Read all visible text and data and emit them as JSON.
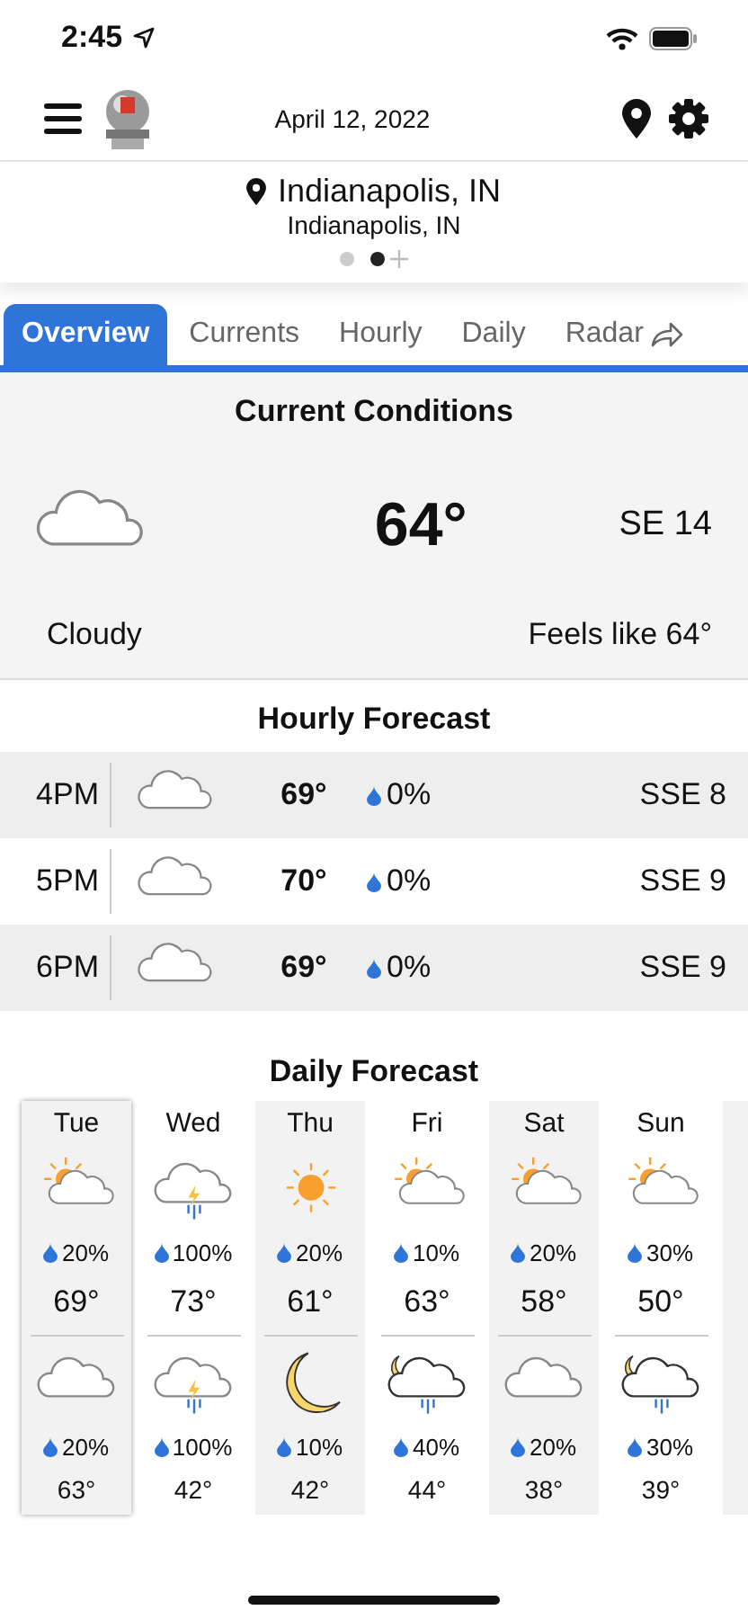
{
  "status_bar": {
    "time": "2:45"
  },
  "header": {
    "date": "April 12, 2022"
  },
  "location": {
    "name": "Indianapolis, IN",
    "subtitle": "Indianapolis, IN",
    "pages": [
      {
        "selected": false
      },
      {
        "selected": true
      }
    ]
  },
  "tabs": [
    {
      "label": "Overview",
      "selected": true
    },
    {
      "label": "Currents",
      "selected": false
    },
    {
      "label": "Hourly",
      "selected": false
    },
    {
      "label": "Daily",
      "selected": false
    },
    {
      "label": "Radar",
      "selected": false
    }
  ],
  "current": {
    "title": "Current Conditions",
    "temperature": "64°",
    "wind": "SE 14",
    "condition": "Cloudy",
    "feels_like": "Feels like 64°"
  },
  "hourly": {
    "title": "Hourly Forecast",
    "rows": [
      {
        "time": "4PM",
        "temp": "69°",
        "precip": "0%",
        "wind": "SSE 8"
      },
      {
        "time": "5PM",
        "temp": "70°",
        "precip": "0%",
        "wind": "SSE 9"
      },
      {
        "time": "6PM",
        "temp": "69°",
        "precip": "0%",
        "wind": "SSE 9"
      }
    ]
  },
  "daily": {
    "title": "Daily Forecast",
    "days": [
      {
        "day": "Tue",
        "selected": true,
        "day_precip": "20%",
        "high": "69°",
        "night_precip": "20%",
        "low": "63°"
      },
      {
        "day": "Wed",
        "selected": false,
        "day_precip": "100%",
        "high": "73°",
        "night_precip": "100%",
        "low": "42°"
      },
      {
        "day": "Thu",
        "selected": false,
        "day_precip": "20%",
        "high": "61°",
        "night_precip": "10%",
        "low": "42°"
      },
      {
        "day": "Fri",
        "selected": false,
        "day_precip": "10%",
        "high": "63°",
        "night_precip": "40%",
        "low": "44°"
      },
      {
        "day": "Sat",
        "selected": false,
        "day_precip": "20%",
        "high": "58°",
        "night_precip": "20%",
        "low": "38°"
      },
      {
        "day": "Sun",
        "selected": false,
        "day_precip": "30%",
        "high": "50°",
        "night_precip": "30%",
        "low": "39°"
      }
    ]
  }
}
